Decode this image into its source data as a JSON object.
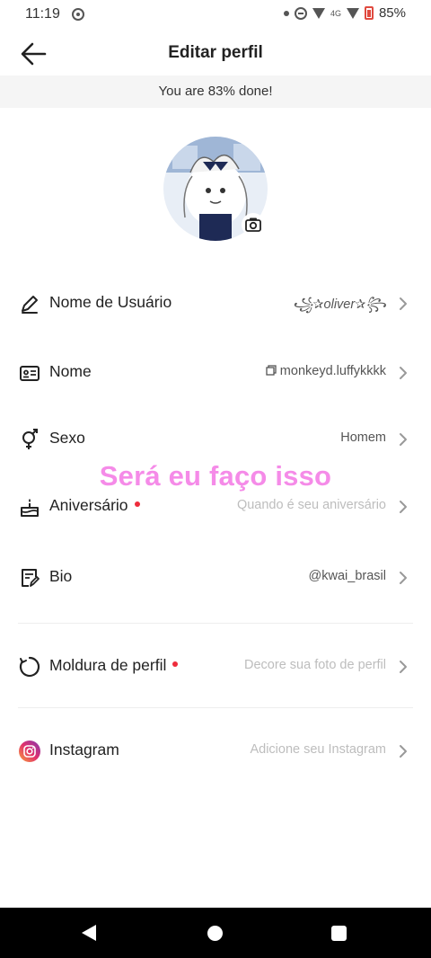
{
  "status_bar": {
    "time": "11:19",
    "network": "4G",
    "battery": "85%"
  },
  "header": {
    "title": "Editar perfil",
    "back_icon": "arrow-left-icon"
  },
  "progress_banner": "You are 83% done!",
  "profile_rows": [
    {
      "label": "Nome de Usuário",
      "value": "꧁✰oliver✰꧂",
      "icon": "pencil-icon"
    },
    {
      "label": "Nome",
      "value": "monkeyd.luffykkkk",
      "icon": "id-card-icon",
      "value_icon": "copy-icon"
    },
    {
      "label": "Sexo",
      "value": "Homem",
      "icon": "gender-icon"
    },
    {
      "label": "Aniversário",
      "value": "Quando é seu aniversário",
      "icon": "cake-icon",
      "dot": true
    },
    {
      "label": "Bio",
      "value": "@kwai_brasil",
      "icon": "bio-edit-icon"
    },
    {
      "label": "Moldura de perfil",
      "value": "Decore sua foto de perfil",
      "icon": "frame-icon",
      "dot": true
    },
    {
      "label": "Instagram",
      "value": "Adicione seu Instagram",
      "icon": "instagram-icon"
    }
  ],
  "overlay_caption": "Será eu faço isso",
  "colors": {
    "accent_dot": "#ee2c3c",
    "caption": "#f58be8",
    "placeholder": "#bdbdbd"
  }
}
